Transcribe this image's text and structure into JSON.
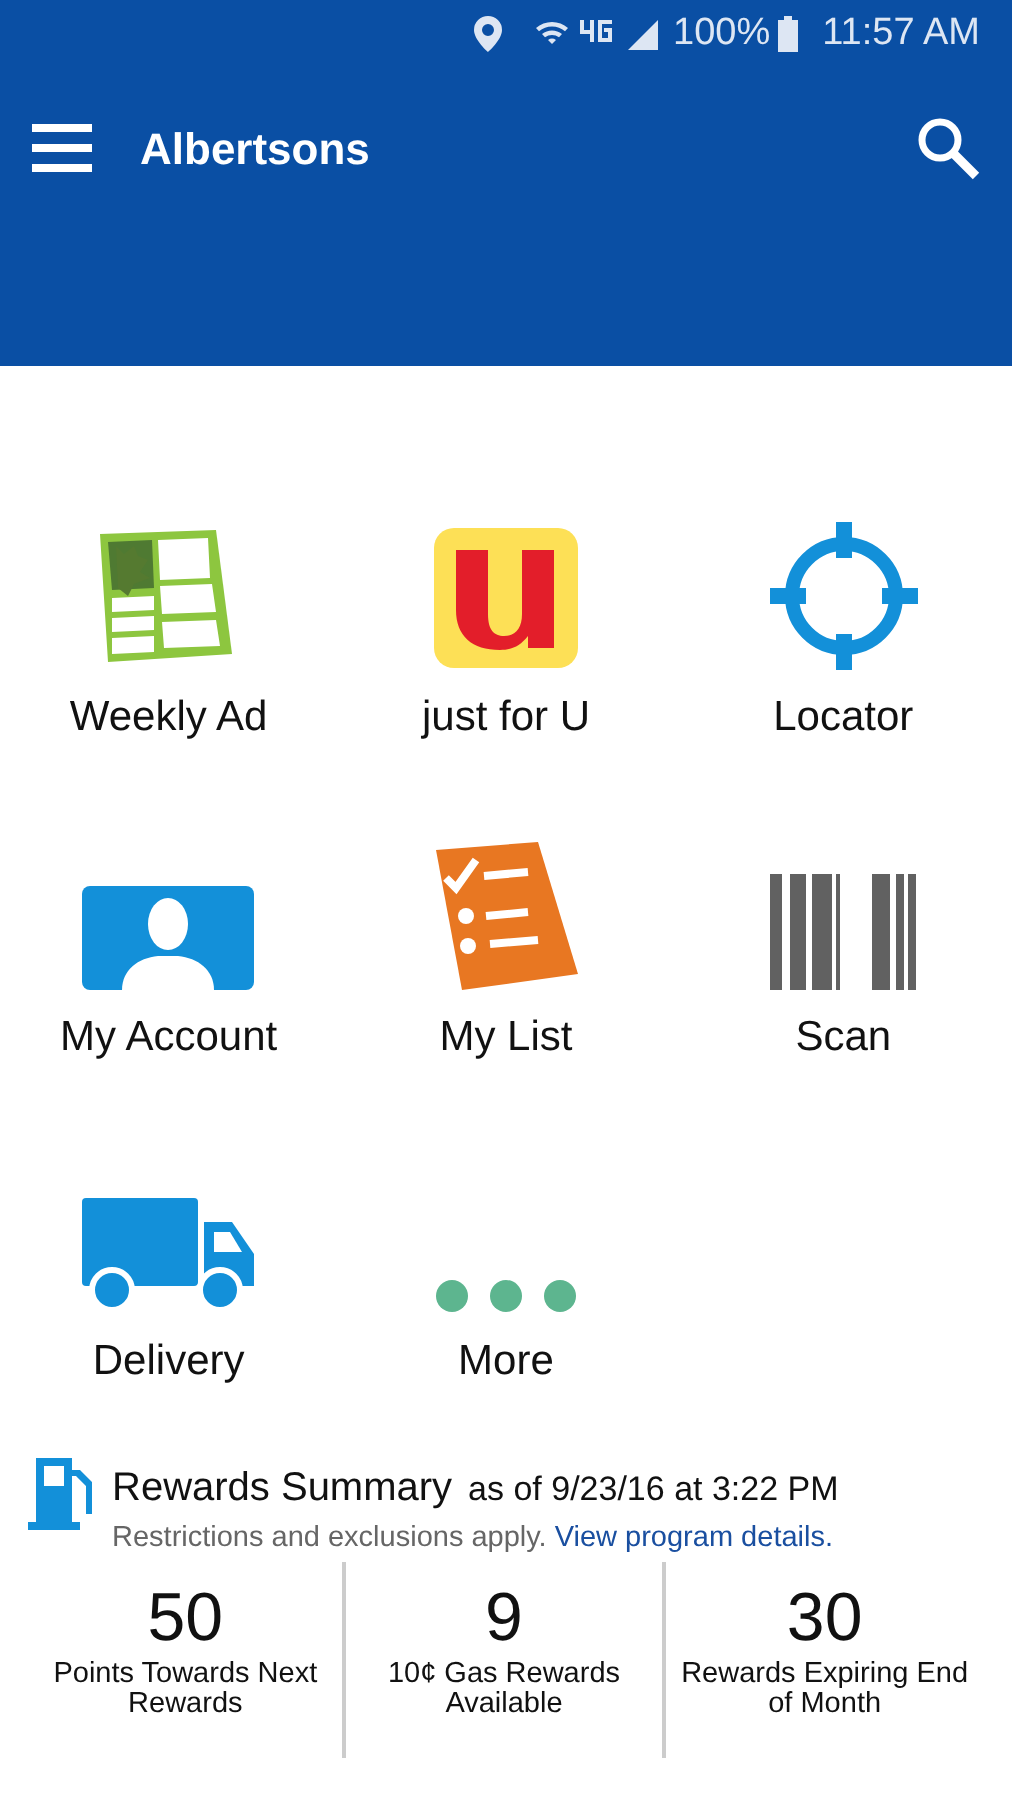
{
  "status_bar": {
    "battery": "100%",
    "time": "11:57 AM"
  },
  "app_bar": {
    "title": "Albertsons"
  },
  "tiles": [
    {
      "label": "Weekly Ad"
    },
    {
      "label": "just for U"
    },
    {
      "label": "Locator"
    },
    {
      "label": "My Account"
    },
    {
      "label": "My List"
    },
    {
      "label": "Scan"
    },
    {
      "label": "Delivery"
    },
    {
      "label": "More"
    }
  ],
  "rewards": {
    "title": "Rewards Summary",
    "as_of": "as of 9/23/16 at 3:22 PM",
    "note": "Restrictions and exclusions apply.",
    "link": "View program details.",
    "stats": [
      {
        "value": "50",
        "label": "Points Towards Next Rewards"
      },
      {
        "value": "9",
        "label": "10¢ Gas Rewards Available"
      },
      {
        "value": "30",
        "label": "Rewards Expiring End of Month"
      }
    ]
  }
}
